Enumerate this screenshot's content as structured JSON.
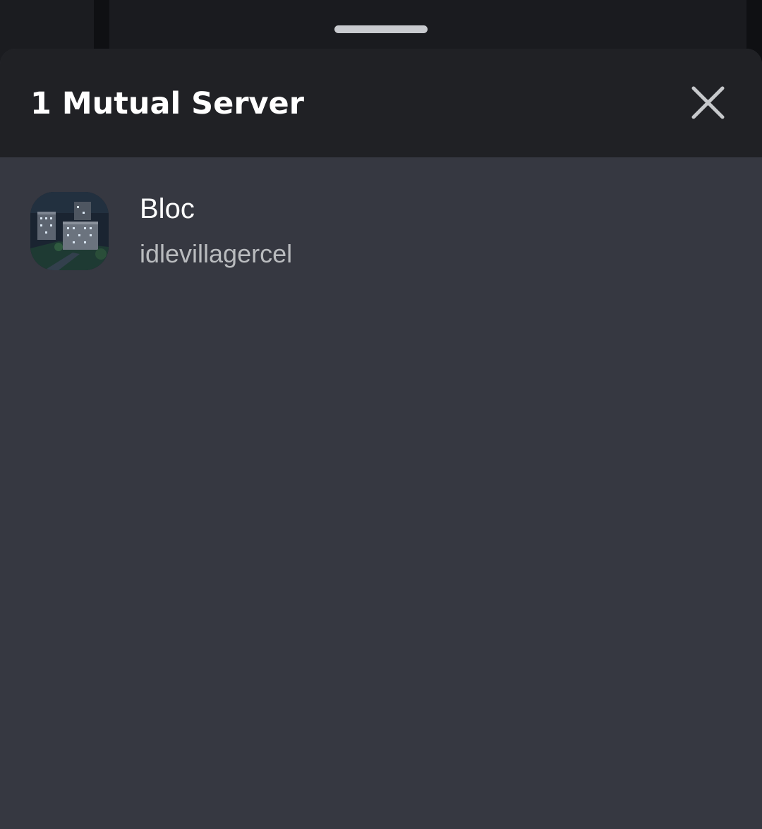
{
  "sheet": {
    "title": "1 Mutual Server",
    "close_icon": "close-icon"
  },
  "servers": [
    {
      "name": "Bloc",
      "nickname": "idlevillagercel",
      "icon": "server-icon-night-apartment-blocks"
    }
  ],
  "colors": {
    "sheet_header_bg": "#202125",
    "sheet_body_bg": "#363841",
    "title_text": "#ffffff",
    "secondary_text": "#b9bbbe",
    "close_icon": "#c7c9cc",
    "drag_handle": "#c9cbcf"
  }
}
